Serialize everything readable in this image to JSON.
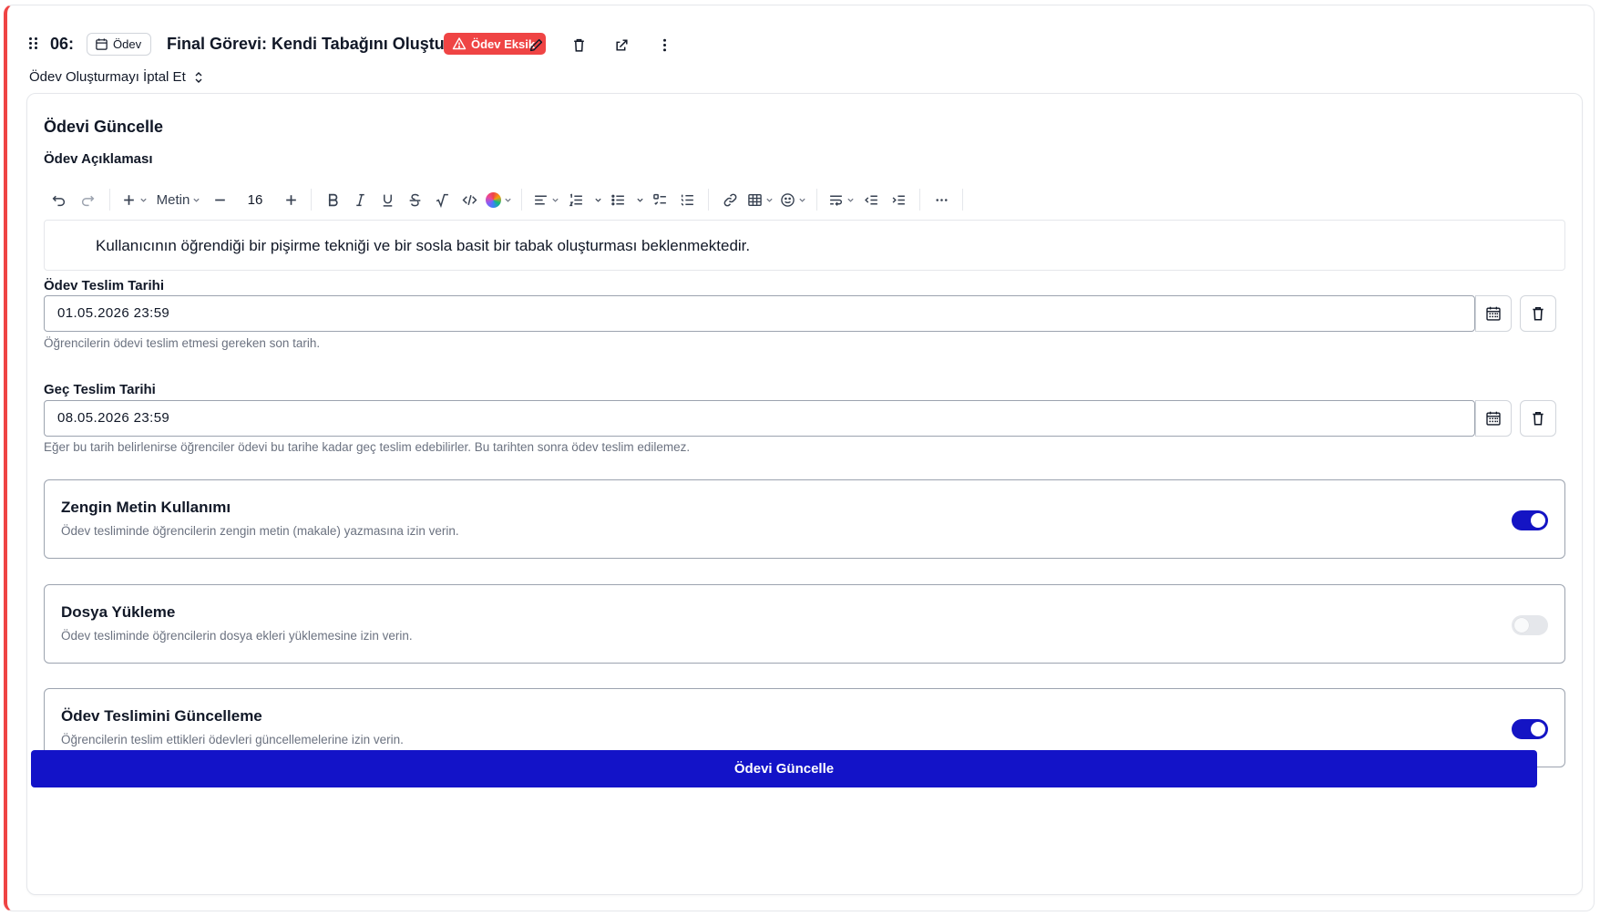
{
  "header": {
    "number": "06:",
    "type_chip": "Ödev",
    "title": "Final Görevi: Kendi Tabağını Oluştur",
    "warning_badge": "Ödev Eksik",
    "cancel_link": "Ödev Oluşturmayı İptal Et"
  },
  "form": {
    "title": "Ödevi Güncelle",
    "description_label": "Ödev Açıklaması",
    "toolbar": {
      "block_type": "Metin",
      "font_size": "16"
    },
    "description_text": "Kullanıcının öğrendiği bir pişirme tekniği ve bir sosla basit bir tabak oluşturması beklenmektedir.",
    "due_date": {
      "label": "Ödev Teslim Tarihi",
      "value": "01.05.2026 23:59",
      "help": "Öğrencilerin ödevi teslim etmesi gereken son tarih."
    },
    "late_date": {
      "label": "Geç Teslim Tarihi",
      "value": "08.05.2026 23:59",
      "help": "Eğer bu tarih belirlenirse öğrenciler ödevi bu tarihe kadar geç teslim edebilirler. Bu tarihten sonra ödev teslim edilemez."
    },
    "options": [
      {
        "title": "Zengin Metin Kullanımı",
        "description": "Ödev tesliminde öğrencilerin zengin metin (makale) yazmasına izin verin.",
        "enabled": true
      },
      {
        "title": "Dosya Yükleme",
        "description": "Ödev tesliminde öğrencilerin dosya ekleri yüklemesine izin verin.",
        "enabled": false
      },
      {
        "title": "Ödev Teslimini Güncelleme",
        "description": "Öğrencilerin teslim ettikleri ödevleri güncellemelerine izin verin.",
        "enabled": true
      }
    ],
    "submit_label": "Ödevi Güncelle"
  },
  "colors": {
    "accent": "#1313c8",
    "danger": "#ef4444",
    "muted_text": "#6b7280"
  }
}
